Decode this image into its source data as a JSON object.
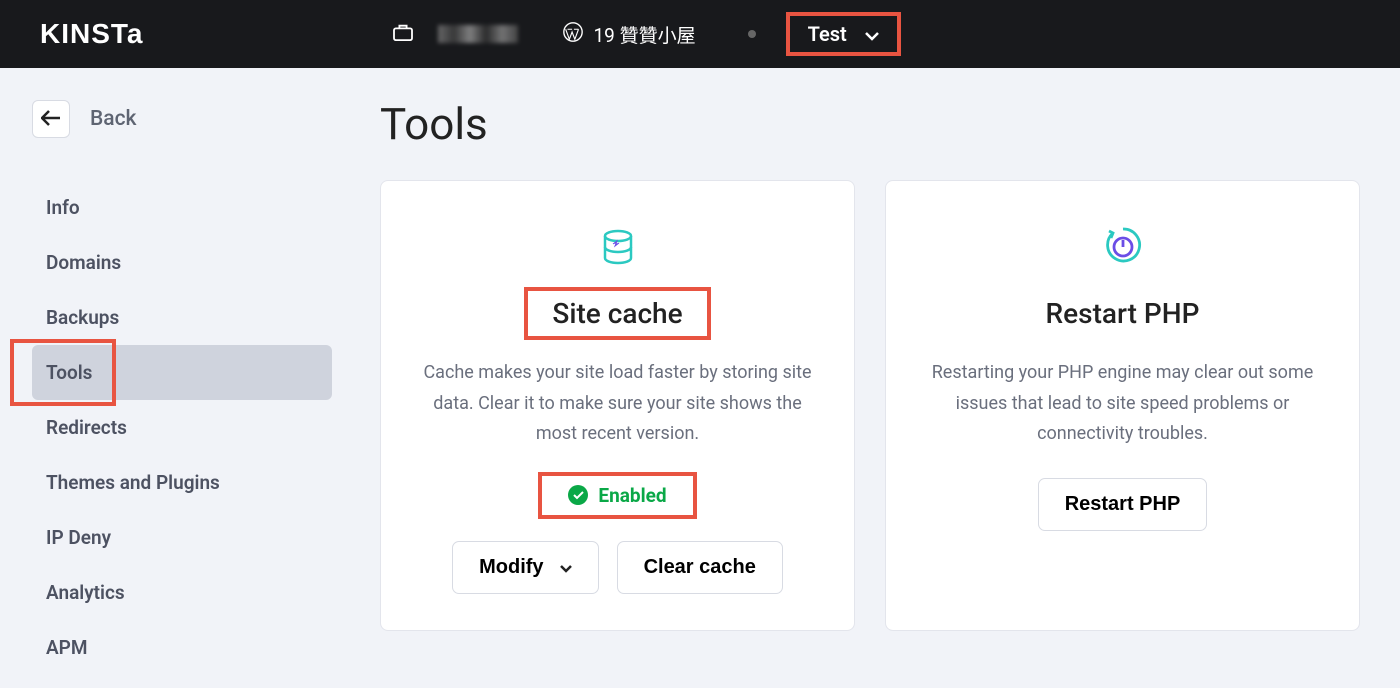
{
  "brand": "KINSTa",
  "topbar": {
    "site_name": "19 贊贊小屋",
    "env_label": "Test"
  },
  "sidebar": {
    "back_label": "Back",
    "items": [
      {
        "label": "Info"
      },
      {
        "label": "Domains"
      },
      {
        "label": "Backups"
      },
      {
        "label": "Tools"
      },
      {
        "label": "Redirects"
      },
      {
        "label": "Themes and Plugins"
      },
      {
        "label": "IP Deny"
      },
      {
        "label": "Analytics"
      },
      {
        "label": "APM"
      }
    ]
  },
  "page_title": "Tools",
  "cards": {
    "cache": {
      "title": "Site cache",
      "desc": "Cache makes your site load faster by storing site data. Clear it to make sure your site shows the most recent version.",
      "status": "Enabled",
      "modify_label": "Modify",
      "clear_label": "Clear cache"
    },
    "php": {
      "title": "Restart PHP",
      "desc": "Restarting your PHP engine may clear out some issues that lead to site speed problems or connectivity troubles.",
      "restart_label": "Restart PHP"
    }
  }
}
